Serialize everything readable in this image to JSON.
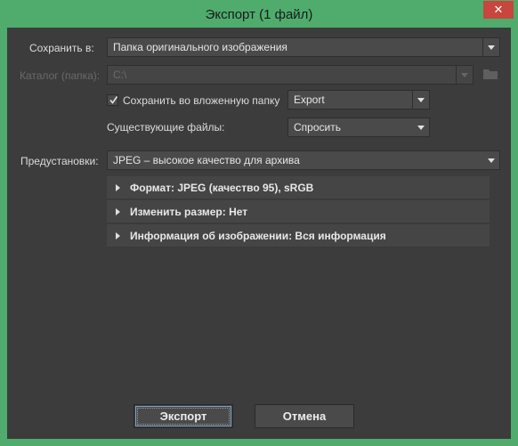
{
  "window": {
    "title": "Экспорт (1 файл)",
    "close_label": "✕"
  },
  "form": {
    "save_to_label": "Сохранить в:",
    "save_to_value": "Папка оригинального изображения",
    "folder_label": "Каталог (папка):",
    "folder_value": "C:\\",
    "subfolder_checkbox_label": "Сохранить во вложенную папку",
    "subfolder_checked": true,
    "subfolder_value": "Export",
    "existing_files_label": "Существующие файлы:",
    "existing_files_value": "Спросить",
    "presets_label": "Предустановки:",
    "presets_value": "JPEG – высокое качество для архива"
  },
  "sections": [
    {
      "label": "Формат: JPEG (качество 95), sRGB"
    },
    {
      "label": "Изменить размер: Нет"
    },
    {
      "label": "Информация об изображении: Вся информация"
    }
  ],
  "buttons": {
    "export": "Экспорт",
    "cancel": "Отмена"
  },
  "colors": {
    "title_bar": "#4fac6d",
    "close_button": "#c7463d",
    "dialog_background": "#3c3c3c"
  }
}
